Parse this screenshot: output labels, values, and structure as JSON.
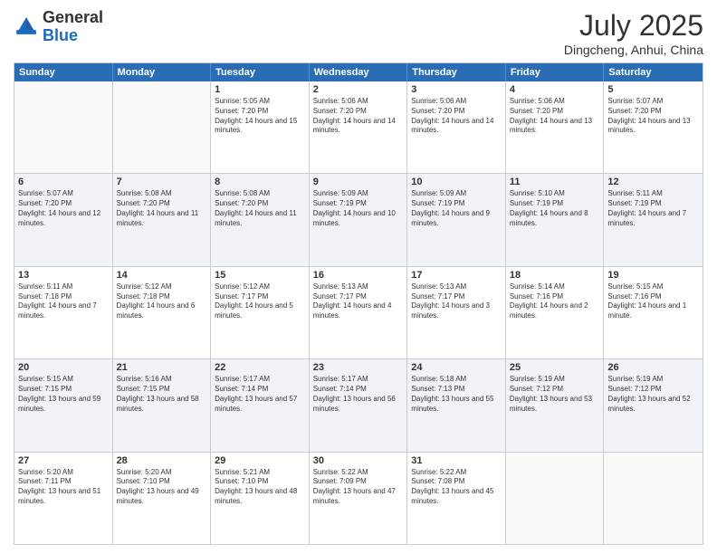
{
  "header": {
    "logo": {
      "general": "General",
      "blue": "Blue"
    },
    "title": "July 2025",
    "subtitle": "Dingcheng, Anhui, China"
  },
  "days": [
    "Sunday",
    "Monday",
    "Tuesday",
    "Wednesday",
    "Thursday",
    "Friday",
    "Saturday"
  ],
  "weeks": [
    [
      {
        "num": "",
        "info": ""
      },
      {
        "num": "",
        "info": ""
      },
      {
        "num": "1",
        "info": "Sunrise: 5:05 AM\nSunset: 7:20 PM\nDaylight: 14 hours and 15 minutes."
      },
      {
        "num": "2",
        "info": "Sunrise: 5:06 AM\nSunset: 7:20 PM\nDaylight: 14 hours and 14 minutes."
      },
      {
        "num": "3",
        "info": "Sunrise: 5:06 AM\nSunset: 7:20 PM\nDaylight: 14 hours and 14 minutes."
      },
      {
        "num": "4",
        "info": "Sunrise: 5:06 AM\nSunset: 7:20 PM\nDaylight: 14 hours and 13 minutes."
      },
      {
        "num": "5",
        "info": "Sunrise: 5:07 AM\nSunset: 7:20 PM\nDaylight: 14 hours and 13 minutes."
      }
    ],
    [
      {
        "num": "6",
        "info": "Sunrise: 5:07 AM\nSunset: 7:20 PM\nDaylight: 14 hours and 12 minutes."
      },
      {
        "num": "7",
        "info": "Sunrise: 5:08 AM\nSunset: 7:20 PM\nDaylight: 14 hours and 11 minutes."
      },
      {
        "num": "8",
        "info": "Sunrise: 5:08 AM\nSunset: 7:20 PM\nDaylight: 14 hours and 11 minutes."
      },
      {
        "num": "9",
        "info": "Sunrise: 5:09 AM\nSunset: 7:19 PM\nDaylight: 14 hours and 10 minutes."
      },
      {
        "num": "10",
        "info": "Sunrise: 5:09 AM\nSunset: 7:19 PM\nDaylight: 14 hours and 9 minutes."
      },
      {
        "num": "11",
        "info": "Sunrise: 5:10 AM\nSunset: 7:19 PM\nDaylight: 14 hours and 8 minutes."
      },
      {
        "num": "12",
        "info": "Sunrise: 5:11 AM\nSunset: 7:19 PM\nDaylight: 14 hours and 7 minutes."
      }
    ],
    [
      {
        "num": "13",
        "info": "Sunrise: 5:11 AM\nSunset: 7:18 PM\nDaylight: 14 hours and 7 minutes."
      },
      {
        "num": "14",
        "info": "Sunrise: 5:12 AM\nSunset: 7:18 PM\nDaylight: 14 hours and 6 minutes."
      },
      {
        "num": "15",
        "info": "Sunrise: 5:12 AM\nSunset: 7:17 PM\nDaylight: 14 hours and 5 minutes."
      },
      {
        "num": "16",
        "info": "Sunrise: 5:13 AM\nSunset: 7:17 PM\nDaylight: 14 hours and 4 minutes."
      },
      {
        "num": "17",
        "info": "Sunrise: 5:13 AM\nSunset: 7:17 PM\nDaylight: 14 hours and 3 minutes."
      },
      {
        "num": "18",
        "info": "Sunrise: 5:14 AM\nSunset: 7:16 PM\nDaylight: 14 hours and 2 minutes."
      },
      {
        "num": "19",
        "info": "Sunrise: 5:15 AM\nSunset: 7:16 PM\nDaylight: 14 hours and 1 minute."
      }
    ],
    [
      {
        "num": "20",
        "info": "Sunrise: 5:15 AM\nSunset: 7:15 PM\nDaylight: 13 hours and 59 minutes."
      },
      {
        "num": "21",
        "info": "Sunrise: 5:16 AM\nSunset: 7:15 PM\nDaylight: 13 hours and 58 minutes."
      },
      {
        "num": "22",
        "info": "Sunrise: 5:17 AM\nSunset: 7:14 PM\nDaylight: 13 hours and 57 minutes."
      },
      {
        "num": "23",
        "info": "Sunrise: 5:17 AM\nSunset: 7:14 PM\nDaylight: 13 hours and 56 minutes."
      },
      {
        "num": "24",
        "info": "Sunrise: 5:18 AM\nSunset: 7:13 PM\nDaylight: 13 hours and 55 minutes."
      },
      {
        "num": "25",
        "info": "Sunrise: 5:19 AM\nSunset: 7:12 PM\nDaylight: 13 hours and 53 minutes."
      },
      {
        "num": "26",
        "info": "Sunrise: 5:19 AM\nSunset: 7:12 PM\nDaylight: 13 hours and 52 minutes."
      }
    ],
    [
      {
        "num": "27",
        "info": "Sunrise: 5:20 AM\nSunset: 7:11 PM\nDaylight: 13 hours and 51 minutes."
      },
      {
        "num": "28",
        "info": "Sunrise: 5:20 AM\nSunset: 7:10 PM\nDaylight: 13 hours and 49 minutes."
      },
      {
        "num": "29",
        "info": "Sunrise: 5:21 AM\nSunset: 7:10 PM\nDaylight: 13 hours and 48 minutes."
      },
      {
        "num": "30",
        "info": "Sunrise: 5:22 AM\nSunset: 7:09 PM\nDaylight: 13 hours and 47 minutes."
      },
      {
        "num": "31",
        "info": "Sunrise: 5:22 AM\nSunset: 7:08 PM\nDaylight: 13 hours and 45 minutes."
      },
      {
        "num": "",
        "info": ""
      },
      {
        "num": "",
        "info": ""
      }
    ]
  ]
}
